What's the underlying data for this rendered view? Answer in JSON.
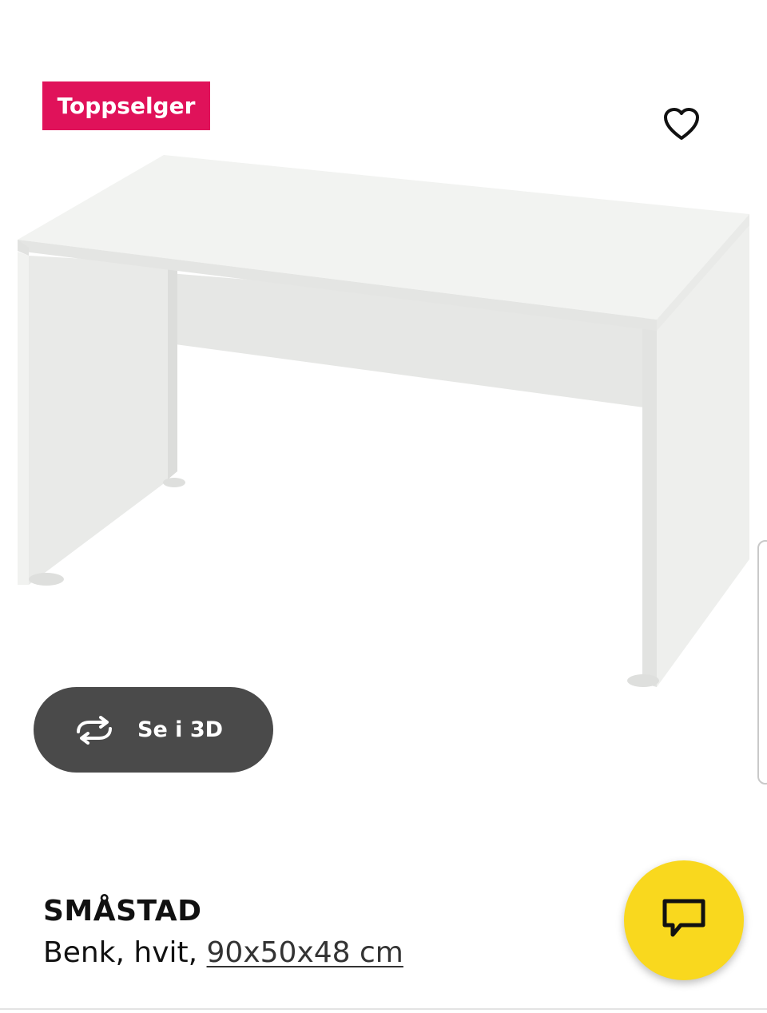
{
  "badge": {
    "label": "Toppselger",
    "color": "#e0125a"
  },
  "favorite": {
    "icon": "heart-outline-icon"
  },
  "view3d": {
    "label": "Se i 3D",
    "icon": "rotate-arrows-icon"
  },
  "product": {
    "name": "SMÅSTAD",
    "description_prefix": "Benk, hvit, ",
    "dimensions": "90x50x48 cm"
  },
  "chat": {
    "icon": "chat-bubble-icon",
    "color": "#f9d81e"
  }
}
